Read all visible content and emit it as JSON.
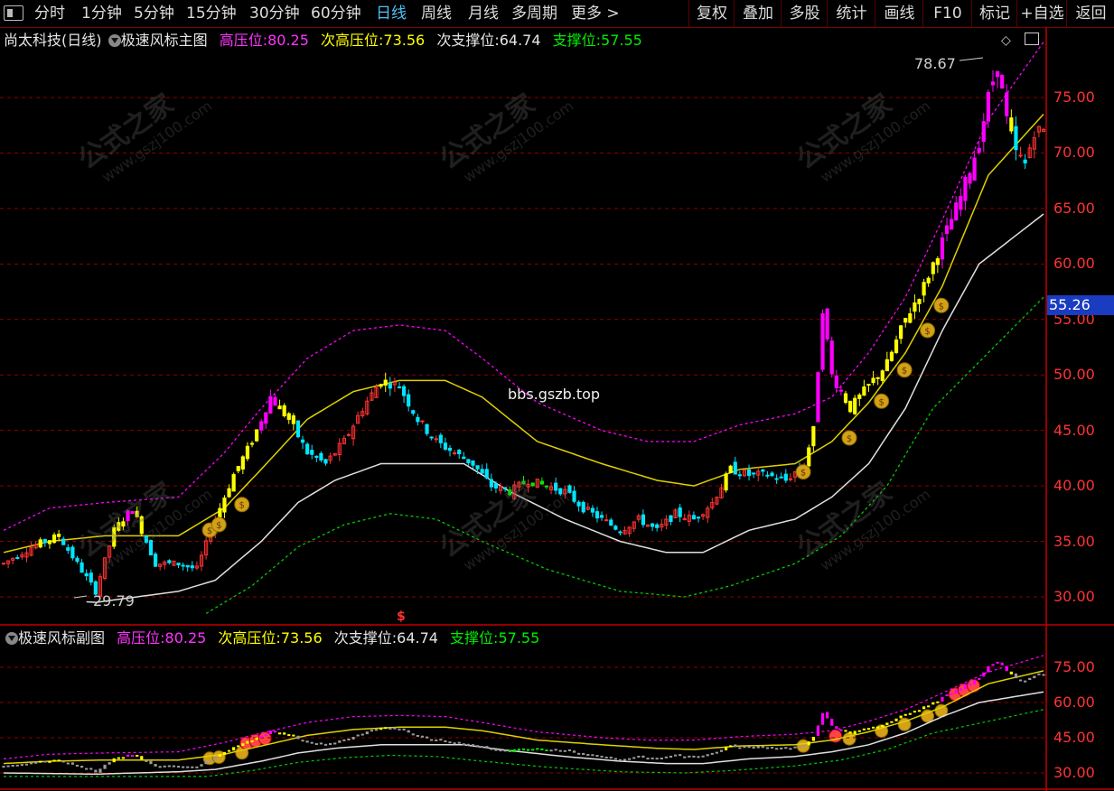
{
  "toolbar": {
    "left": [
      "分时",
      "1分钟",
      "5分钟",
      "15分钟",
      "30分钟",
      "60分钟",
      "日线",
      "周线",
      "月线",
      "多周期",
      "更多 >"
    ],
    "active": "日线",
    "right": [
      "复权",
      "叠加",
      "多股",
      "统计",
      "画线",
      "F10",
      "标记",
      "+自选",
      "返回"
    ]
  },
  "main_legend": {
    "stock": "尚太科技(日线)",
    "indicator": "极速风标主图",
    "high_label": "高压位:",
    "high_value": "80.25",
    "sub_high_label": "次高压位:",
    "sub_high_value": "73.56",
    "sub_support_label": "次支撑位:",
    "sub_support_value": "64.74",
    "support_label": "支撑位:",
    "support_value": "57.55"
  },
  "sub_legend": {
    "indicator": "极速风标副图",
    "high_label": "高压位:",
    "high_value": "80.25",
    "sub_high_label": "次高压位:",
    "sub_high_value": "73.56",
    "sub_support_label": "次支撑位:",
    "sub_support_value": "64.74",
    "support_label": "支撑位:",
    "support_value": "57.55"
  },
  "current_price": "55.26",
  "watermark_text": "公式之家",
  "watermark_url": "www.gszj100.com",
  "overlay_text": "bbs.gszb.top",
  "annotations": {
    "max_label": "78.67",
    "min_label": "29.79",
    "signal_mark": "$"
  },
  "colors": {
    "up": "#ff3333",
    "down": "#00e5ff",
    "yellow": "#ffff00",
    "magenta": "#ff00ff",
    "support": "#00cc00",
    "white_line": "#e0e0e0",
    "grid": "#8b0000"
  },
  "chart_data": [
    {
      "type": "candlestick",
      "name": "main",
      "ylim": [
        28,
        80
      ],
      "ticks": [
        30,
        35,
        40,
        45,
        50,
        55,
        60,
        65,
        70,
        75
      ],
      "tick_labels": [
        "30.00",
        "35.00",
        "40.00",
        "45.00",
        "50.00",
        "55.00",
        "60.00",
        "65.00",
        "70.00",
        "75.00"
      ],
      "price_path": [
        [
          0,
          33
        ],
        [
          6,
          34.5
        ],
        [
          12,
          35.5
        ],
        [
          16,
          33
        ],
        [
          20,
          30.5
        ],
        [
          24,
          36
        ],
        [
          28,
          38
        ],
        [
          33,
          33
        ],
        [
          38,
          33
        ],
        [
          42,
          32.5
        ],
        [
          46,
          37
        ],
        [
          50,
          41
        ],
        [
          54,
          44
        ],
        [
          58,
          48
        ],
        [
          62,
          46
        ],
        [
          66,
          43
        ],
        [
          70,
          42
        ],
        [
          74,
          44
        ],
        [
          78,
          47
        ],
        [
          82,
          49.5
        ],
        [
          86,
          49
        ],
        [
          90,
          46
        ],
        [
          94,
          44
        ],
        [
          98,
          43
        ],
        [
          102,
          42
        ],
        [
          106,
          40
        ],
        [
          110,
          39.5
        ],
        [
          114,
          40.5
        ],
        [
          118,
          40
        ],
        [
          122,
          39.5
        ],
        [
          126,
          38
        ],
        [
          130,
          37
        ],
        [
          134,
          36
        ],
        [
          138,
          37
        ],
        [
          142,
          36
        ],
        [
          146,
          37.5
        ],
        [
          150,
          37
        ],
        [
          154,
          38.5
        ],
        [
          158,
          41.5
        ],
        [
          162,
          41
        ],
        [
          166,
          41
        ],
        [
          170,
          40.5
        ],
        [
          174,
          42
        ],
        [
          176,
          45
        ],
        [
          178,
          56
        ],
        [
          180,
          50
        ],
        [
          184,
          47
        ],
        [
          188,
          49
        ],
        [
          192,
          51
        ],
        [
          196,
          55
        ],
        [
          200,
          58
        ],
        [
          204,
          62
        ],
        [
          208,
          66
        ],
        [
          212,
          71
        ],
        [
          214,
          75
        ],
        [
          216,
          78
        ],
        [
          218,
          73
        ],
        [
          220,
          70
        ],
        [
          222,
          69
        ],
        [
          224,
          72
        ],
        [
          226,
          72
        ]
      ],
      "white_line": [
        [
          0,
          30
        ],
        [
          20,
          29.5
        ],
        [
          38,
          30.5
        ],
        [
          46,
          31.5
        ],
        [
          56,
          35
        ],
        [
          64,
          38.5
        ],
        [
          72,
          40.5
        ],
        [
          82,
          42
        ],
        [
          92,
          42
        ],
        [
          100,
          42
        ],
        [
          110,
          39.5
        ],
        [
          122,
          37
        ],
        [
          134,
          35
        ],
        [
          144,
          34
        ],
        [
          152,
          34
        ],
        [
          162,
          36
        ],
        [
          172,
          37
        ],
        [
          180,
          39
        ],
        [
          188,
          42
        ],
        [
          196,
          47
        ],
        [
          204,
          54
        ],
        [
          212,
          60
        ],
        [
          226,
          64.5
        ]
      ],
      "yellow_line": [
        [
          0,
          34
        ],
        [
          10,
          35
        ],
        [
          22,
          35.5
        ],
        [
          38,
          35.5
        ],
        [
          48,
          38
        ],
        [
          56,
          41.5
        ],
        [
          66,
          46
        ],
        [
          76,
          48.5
        ],
        [
          86,
          49.5
        ],
        [
          96,
          49.5
        ],
        [
          104,
          48
        ],
        [
          116,
          44
        ],
        [
          130,
          42
        ],
        [
          142,
          40.5
        ],
        [
          150,
          40
        ],
        [
          160,
          41.5
        ],
        [
          172,
          42
        ],
        [
          180,
          44
        ],
        [
          188,
          47.5
        ],
        [
          196,
          52
        ],
        [
          204,
          58
        ],
        [
          214,
          68
        ],
        [
          226,
          73.5
        ]
      ],
      "magenta_line": [
        [
          0,
          36
        ],
        [
          10,
          38
        ],
        [
          22,
          38.5
        ],
        [
          38,
          39
        ],
        [
          48,
          43
        ],
        [
          56,
          47
        ],
        [
          66,
          51.5
        ],
        [
          76,
          54
        ],
        [
          86,
          54.5
        ],
        [
          96,
          54
        ],
        [
          104,
          51.5
        ],
        [
          116,
          47.5
        ],
        [
          130,
          45
        ],
        [
          140,
          44
        ],
        [
          150,
          44
        ],
        [
          160,
          45.5
        ],
        [
          172,
          46.5
        ],
        [
          180,
          48
        ],
        [
          188,
          52
        ],
        [
          196,
          57
        ],
        [
          204,
          64
        ],
        [
          214,
          73
        ],
        [
          226,
          80
        ]
      ],
      "green_line": [
        [
          44,
          28.5
        ],
        [
          54,
          31
        ],
        [
          64,
          34.5
        ],
        [
          74,
          36.5
        ],
        [
          84,
          37.5
        ],
        [
          94,
          37
        ],
        [
          104,
          35
        ],
        [
          118,
          32.5
        ],
        [
          134,
          30.5
        ],
        [
          148,
          30
        ],
        [
          158,
          31
        ],
        [
          172,
          33
        ],
        [
          182,
          35.5
        ],
        [
          192,
          40
        ],
        [
          202,
          47
        ],
        [
          214,
          52
        ],
        [
          226,
          57
        ]
      ],
      "signal_indices": [
        44,
        46,
        51,
        173,
        183,
        190,
        195,
        200,
        203
      ]
    },
    {
      "type": "candlestick",
      "name": "sub",
      "ylim": [
        25,
        82
      ],
      "ticks": [
        30,
        45,
        60,
        75
      ],
      "tick_labels": [
        "30.00",
        "45.00",
        "60.00",
        "75.00"
      ]
    }
  ]
}
